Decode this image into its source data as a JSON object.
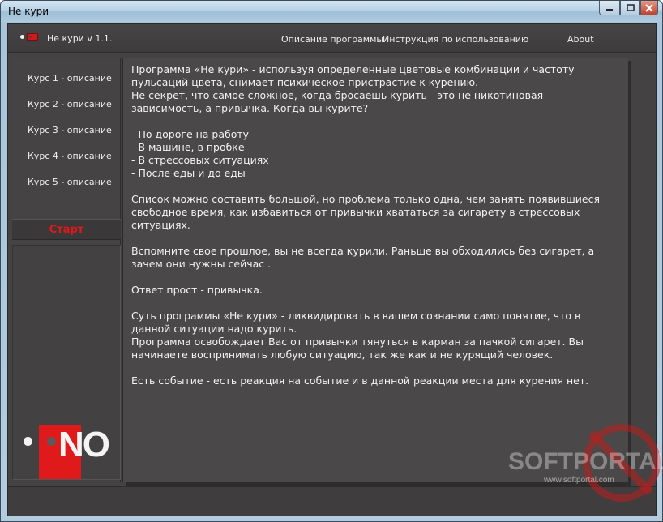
{
  "window": {
    "title": "Не кури"
  },
  "header": {
    "app_version": "Не кури v 1.1.",
    "menu": {
      "description": "Описание программы",
      "instructions": "Инструкция по использованию",
      "about": "About"
    }
  },
  "sidebar": {
    "courses": [
      "Курс 1 - описание",
      "Курс 2 - описание",
      "Курс 3 - описание",
      "Курс 4 - описание",
      "Курс 5 - описание"
    ],
    "start_label": "Старт",
    "logo_text": "NO"
  },
  "content": {
    "p1": [
      "Программа «Не кури» - используя определенные цветовые  комбинации и частоту",
      "пульсаций цвета, снимает психическое пристрастие к курению.",
      "Не секрет, что самое сложное, когда бросаешь курить - это не никотиновая",
      "зависимость, а привычка.  Когда вы курите?"
    ],
    "p2": [
      "- По дороге на работу",
      "- В машине, в пробке",
      "- В стрессовых ситуациях",
      "- После еды и до еды"
    ],
    "p3": [
      "Список можно составить большой, но проблема только одна, чем занять появившиеся",
      "свободное время, как избавиться от привычки хвататься за сигарету в стрессовых",
      "ситуациях."
    ],
    "p4": [
      "Вспомните свое прошлое, вы не всегда курили. Раньше вы обходились без сигарет, а",
      "зачем они нужны сейчас ."
    ],
    "p5": [
      "Ответ прост - привычка."
    ],
    "p6": [
      "Суть программы «Не кури» - ликвидировать в вашем сознании само понятие, что в",
      "данной ситуации надо курить.",
      "Программа освобождает Вас от привычки тянуться в карман за пачкой сигарет. Вы",
      "начинаете воспринимать любую ситуацию, так же как и не курящий человек."
    ],
    "p7": [
      "Есть событие - есть реакция на событие и в данной реакции места для курения нет."
    ]
  },
  "watermark": {
    "brand": "SOFTPORTAL",
    "url": "www.softportal.com"
  },
  "colors": {
    "background": "#444242",
    "accent_red": "#e01818",
    "text": "#f2f2f2"
  }
}
